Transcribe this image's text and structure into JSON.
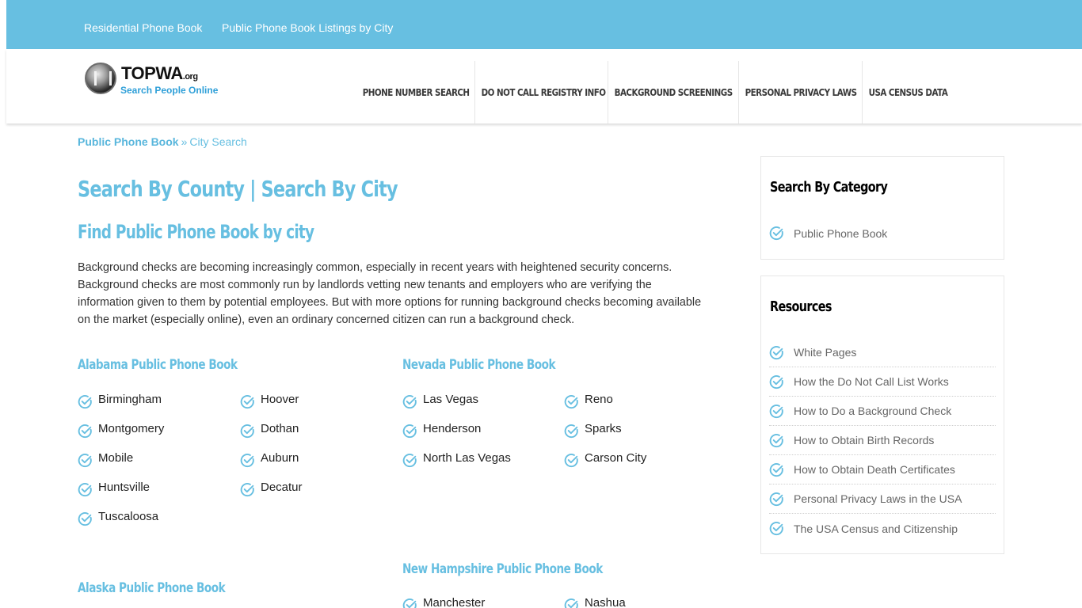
{
  "topbar": {
    "links": [
      "Residential Phone Book",
      "Public Phone Book Listings by City"
    ]
  },
  "brand": {
    "name": "TOPWA",
    "tld": ".org",
    "tagline": "Search People Online",
    "colors": {
      "accent": "#67bfe1",
      "tagline": "#2e9fd8",
      "text": "#333333"
    }
  },
  "nav": {
    "items": [
      "PHONE NUMBER SEARCH",
      "DO NOT CALL REGISTRY INFO",
      "BACKGROUND SCREENINGS",
      "PERSONAL PRIVACY LAWS",
      "USA CENSUS DATA"
    ]
  },
  "breadcrumb": {
    "home": "Public Phone Book",
    "separator": "»",
    "current": "City Search"
  },
  "main": {
    "title": "Search By County | Search By City",
    "subtitle": "Find Public Phone Book by city",
    "intro": "Background checks are becoming increasingly common, especially in recent years with heightened security concerns. Background checks are most commonly run by landlords vetting new tenants and employers who are verifying the information given to them by potential employees. But with more options for running background checks becoming available on the market (especially online), even an ordinary concerned citizen can run a background check.",
    "states": [
      {
        "title": "Alabama Public Phone Book",
        "cities": [
          "Birmingham",
          "Hoover",
          "Montgomery",
          "Dothan",
          "Mobile",
          "Auburn",
          "Huntsville",
          "Decatur",
          "Tuscaloosa"
        ]
      },
      {
        "title": "Nevada Public Phone Book",
        "cities": [
          "Las Vegas",
          "Reno",
          "Henderson",
          "Sparks",
          "North Las Vegas",
          "Carson City"
        ]
      },
      {
        "title": "New Hampshire Public Phone Book",
        "cities": [
          "Manchester",
          "Nashua"
        ]
      },
      {
        "title": "Alaska Public Phone Book",
        "cities": []
      }
    ]
  },
  "sidebar": {
    "category": {
      "title": "Search By Category",
      "items": [
        "Public Phone Book"
      ]
    },
    "resources": {
      "title": "Resources",
      "items": [
        "White Pages",
        "How the Do Not Call List Works",
        "How to Do a Background Check",
        "How to Obtain Birth Records",
        "How to Obtain Death Certificates",
        "Personal Privacy Laws in the USA",
        "The USA Census and Citizenship"
      ]
    }
  },
  "icons": {
    "list_bullet": "check-circle-icon",
    "logo": "phonebook-logo-icon"
  }
}
